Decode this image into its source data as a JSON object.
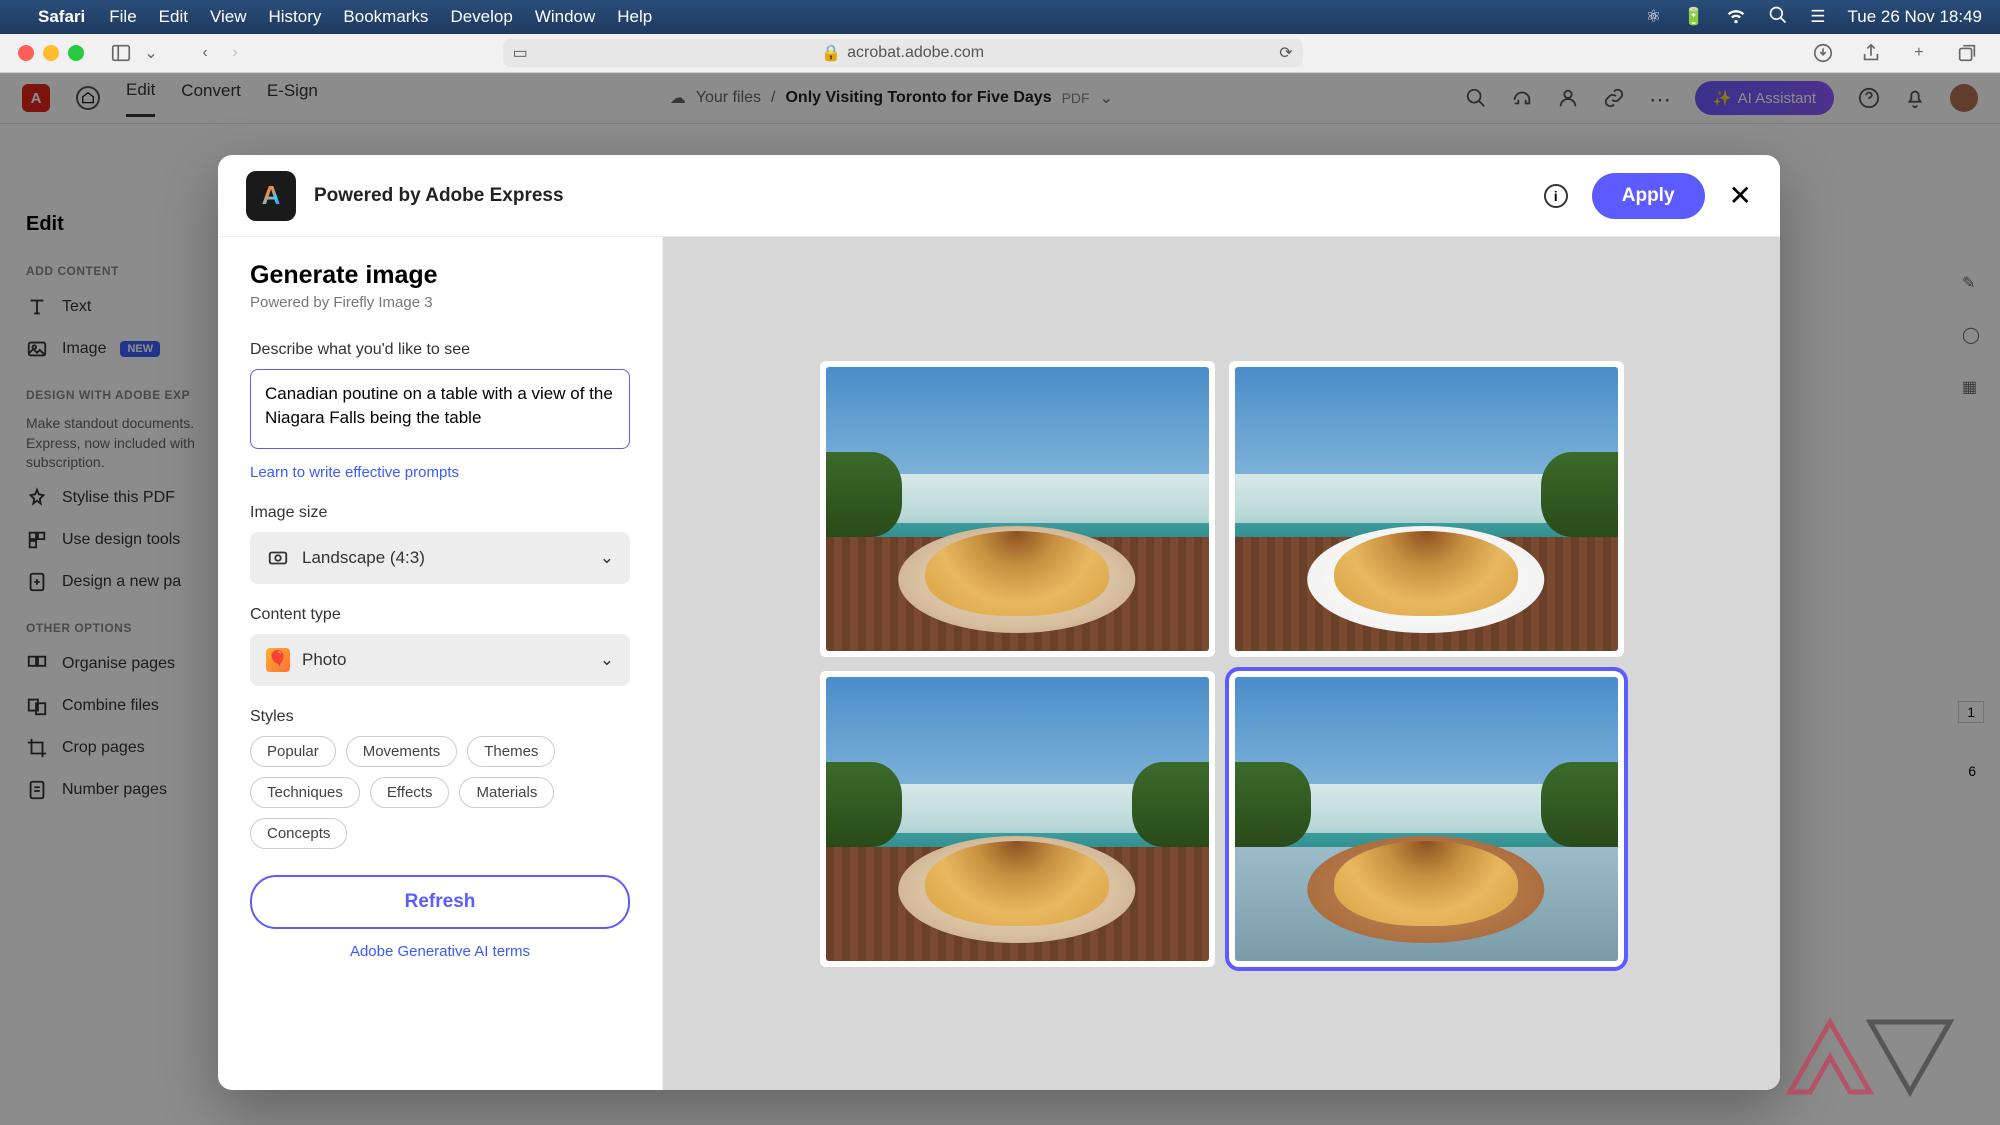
{
  "menubar": {
    "app": "Safari",
    "items": [
      "File",
      "Edit",
      "View",
      "History",
      "Bookmarks",
      "Develop",
      "Window",
      "Help"
    ],
    "clock": "Tue 26 Nov  18:49"
  },
  "safari": {
    "url": "acrobat.adobe.com"
  },
  "acrobat": {
    "tabs": [
      "Edit",
      "Convert",
      "E-Sign"
    ],
    "crumb_prefix": "Your files",
    "filename": "Only Visiting Toronto for Five Days",
    "ext": "PDF",
    "ai_btn": "AI Assistant"
  },
  "sidebar": {
    "title": "Edit",
    "sec_add": "ADD CONTENT",
    "item_text": "Text",
    "item_image": "Image",
    "badge_new": "NEW",
    "sec_design": "DESIGN WITH ADOBE EXP",
    "para": "Make standout documents. Express, now included with subscription.",
    "item_stylise": "Stylise this PDF",
    "item_design": "Use design tools",
    "item_newpage": "Design a new pa",
    "sec_other": "OTHER OPTIONS",
    "item_organise": "Organise pages",
    "item_combine": "Combine files",
    "item_crop": "Crop pages",
    "item_number": "Number pages"
  },
  "modal": {
    "powered": "Powered by Adobe Express",
    "apply": "Apply",
    "h2": "Generate image",
    "sub": "Powered by Firefly Image 3",
    "lbl_describe": "Describe what you'd like to see",
    "prompt": "Canadian poutine on a table with a view of the Niagara Falls being the table",
    "link_prompts": "Learn to write effective prompts",
    "lbl_size": "Image size",
    "size_value": "Landscape (4:3)",
    "lbl_content": "Content type",
    "content_value": "Photo",
    "lbl_styles": "Styles",
    "chips": [
      "Popular",
      "Movements",
      "Themes",
      "Techniques",
      "Effects",
      "Materials",
      "Concepts"
    ],
    "refresh": "Refresh",
    "terms": "Adobe Generative AI terms"
  },
  "pages": {
    "current": "1",
    "total": "6"
  }
}
